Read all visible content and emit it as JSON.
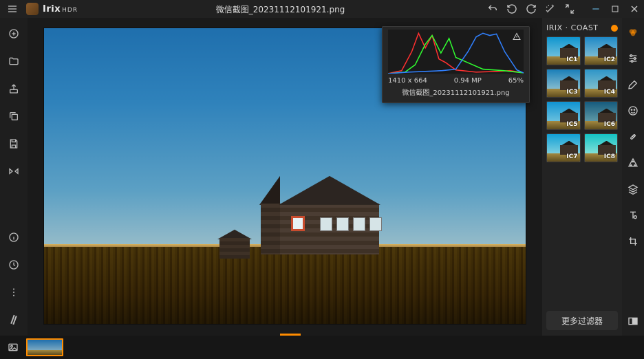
{
  "app": {
    "name": "Irix",
    "sub": "HDR",
    "title": "微信截图_20231112101921.png"
  },
  "window": {
    "min": "—",
    "max": "☐",
    "close": "✕"
  },
  "histogram": {
    "dimensions": "1410 x 664",
    "megapixels": "0.94 MP",
    "zoom": "65%",
    "filename": "微信截图_20231112101921.png"
  },
  "rpanel": {
    "title": "IRIX · COAST",
    "presets": [
      {
        "label": "IC1",
        "sky1": "#0f95cf",
        "sky2": "#93cfe0"
      },
      {
        "label": "IC2",
        "sky1": "#1f88c6",
        "sky2": "#9fd0d8"
      },
      {
        "label": "IC3",
        "sky1": "#1a7fb9",
        "sky2": "#b0d4d6"
      },
      {
        "label": "IC4",
        "sky1": "#2e95c8",
        "sky2": "#a0cfcf"
      },
      {
        "label": "IC5",
        "sky1": "#0f93d2",
        "sky2": "#8fd2e2"
      },
      {
        "label": "IC6",
        "sky1": "#165b7d",
        "sky2": "#7cb2b6"
      },
      {
        "label": "IC7",
        "sky1": "#11a0d6",
        "sky2": "#a9e2e2"
      },
      {
        "label": "IC8",
        "sky1": "#14c2c4",
        "sky2": "#aeece0"
      }
    ],
    "more": "更多过滤器"
  }
}
